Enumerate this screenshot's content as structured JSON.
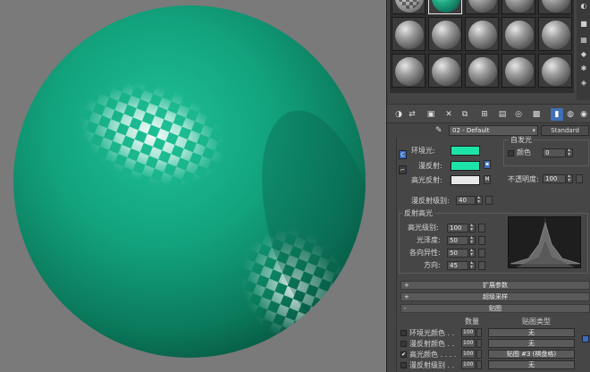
{
  "viewport": {
    "sphere_color": "#12a27c",
    "background": "#7a7a7a"
  },
  "material_editor": {
    "material_name": "02 - Default",
    "material_type": "Standard",
    "basic_params": {
      "ambient_label": "环境光:",
      "diffuse_label": "漫反射:",
      "specular_label": "高光反射:",
      "ambient_color": "#1ee3a8",
      "diffuse_color": "#1ee3a8",
      "specular_color": "#e8e8e8",
      "map_button_label": "M",
      "self_illum_group": "自发光",
      "self_illum_color_label": "颜色",
      "self_illum_value": "0",
      "opacity_label": "不透明度:",
      "opacity_value": "100",
      "diffuse_level_label": "漫反射级别:",
      "diffuse_level_value": "40"
    },
    "specular_highlights": {
      "title": "反射高光",
      "specular_level_label": "高光级别:",
      "specular_level_value": "100",
      "glossiness_label": "光泽度:",
      "glossiness_value": "50",
      "anisotropy_label": "各向异性:",
      "anisotropy_value": "50",
      "orientation_label": "方向:",
      "orientation_value": "45"
    },
    "rollouts": [
      {
        "sign": "+",
        "title": "扩展参数"
      },
      {
        "sign": "+",
        "title": "超级采样"
      },
      {
        "sign": "-",
        "title": "贴图"
      }
    ],
    "maps": {
      "amount_header": "数量",
      "maptype_header": "贴图类型",
      "rows": [
        {
          "label": "环境光颜色 . .",
          "amount": "100",
          "map": "无",
          "checked": ""
        },
        {
          "label": "漫反射颜色 . .",
          "amount": "100",
          "map": "无",
          "checked": ""
        },
        {
          "label": "高光颜色 . . . .",
          "amount": "100",
          "map": "贴图 #3 (棋盘格)",
          "checked": "✔"
        },
        {
          "label": "漫反射级别 . .",
          "amount": "100",
          "map": "无",
          "checked": ""
        }
      ]
    }
  }
}
